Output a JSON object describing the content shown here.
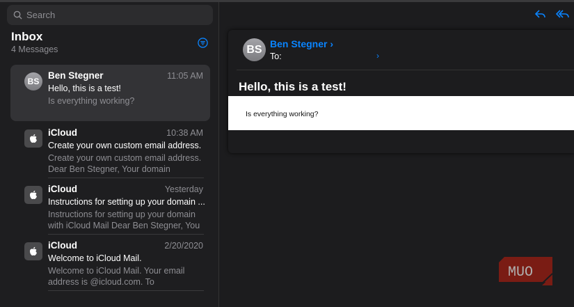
{
  "sidebar": {
    "search_placeholder": "Search",
    "title": "Inbox",
    "count": "4 Messages",
    "messages": [
      {
        "avatar": "BS",
        "from": "Ben Stegner",
        "time": "11:05 AM",
        "subject": "Hello, this is a test!",
        "preview": "Is everything working?"
      },
      {
        "avatar": "apple",
        "from": "iCloud",
        "time": "10:38 AM",
        "subject": "Create your own custom email address.",
        "preview": "Create your own custom email address. Dear Ben Stegner, Your domain"
      },
      {
        "avatar": "apple",
        "from": "iCloud",
        "time": "Yesterday",
        "subject": "Instructions for setting up your domain ...",
        "preview": "Instructions for setting up your domain with iCloud Mail Dear Ben Stegner, You"
      },
      {
        "avatar": "apple",
        "from": "iCloud",
        "time": "2/20/2020",
        "subject": "Welcome to iCloud Mail.",
        "preview": "Welcome to iCloud Mail. Your email address is                        @icloud.com. To"
      }
    ]
  },
  "reader": {
    "avatar": "BS",
    "sender": "Ben Stegner",
    "chevron": "›",
    "to_label": "To:",
    "subject": "Hello, this is a test!",
    "body": "Is everything working?"
  },
  "watermark": "MUO",
  "colors": {
    "accent": "#0a84ff",
    "logo": "#7a1c14"
  }
}
